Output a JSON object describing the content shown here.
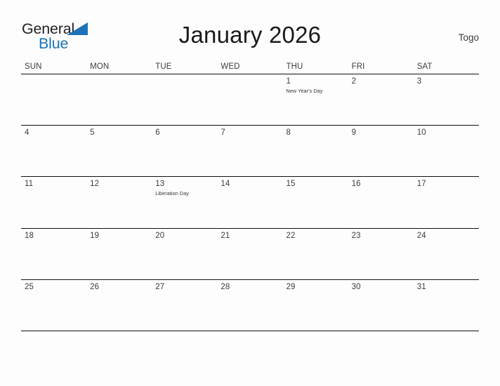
{
  "brand": {
    "name_part1": "General",
    "name_part2": "Blue",
    "triangle_icon": "triangle-icon",
    "blue_hex": "#1b72b8"
  },
  "header": {
    "title": "January 2026",
    "country": "Togo"
  },
  "calendar": {
    "weekdays": [
      "SUN",
      "MON",
      "TUE",
      "WED",
      "THU",
      "FRI",
      "SAT"
    ],
    "weeks": [
      [
        {
          "day": "",
          "event": ""
        },
        {
          "day": "",
          "event": ""
        },
        {
          "day": "",
          "event": ""
        },
        {
          "day": "",
          "event": ""
        },
        {
          "day": "1",
          "event": "New Year's Day"
        },
        {
          "day": "2",
          "event": ""
        },
        {
          "day": "3",
          "event": ""
        }
      ],
      [
        {
          "day": "4",
          "event": ""
        },
        {
          "day": "5",
          "event": ""
        },
        {
          "day": "6",
          "event": ""
        },
        {
          "day": "7",
          "event": ""
        },
        {
          "day": "8",
          "event": ""
        },
        {
          "day": "9",
          "event": ""
        },
        {
          "day": "10",
          "event": ""
        }
      ],
      [
        {
          "day": "11",
          "event": ""
        },
        {
          "day": "12",
          "event": ""
        },
        {
          "day": "13",
          "event": "Liberation Day"
        },
        {
          "day": "14",
          "event": ""
        },
        {
          "day": "15",
          "event": ""
        },
        {
          "day": "16",
          "event": ""
        },
        {
          "day": "17",
          "event": ""
        }
      ],
      [
        {
          "day": "18",
          "event": ""
        },
        {
          "day": "19",
          "event": ""
        },
        {
          "day": "20",
          "event": ""
        },
        {
          "day": "21",
          "event": ""
        },
        {
          "day": "22",
          "event": ""
        },
        {
          "day": "23",
          "event": ""
        },
        {
          "day": "24",
          "event": ""
        }
      ],
      [
        {
          "day": "25",
          "event": ""
        },
        {
          "day": "26",
          "event": ""
        },
        {
          "day": "27",
          "event": ""
        },
        {
          "day": "28",
          "event": ""
        },
        {
          "day": "29",
          "event": ""
        },
        {
          "day": "30",
          "event": ""
        },
        {
          "day": "31",
          "event": ""
        }
      ]
    ]
  }
}
